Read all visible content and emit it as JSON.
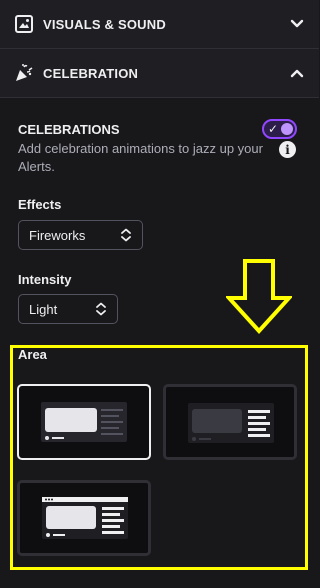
{
  "sections": {
    "visuals": {
      "label": "VISUALS & SOUND",
      "icon": "image-icon",
      "chevron": "chevron-down-icon"
    },
    "celebration": {
      "label": "CELEBRATION",
      "icon": "party-popper-icon",
      "chevron": "chevron-up-icon"
    }
  },
  "celebrations": {
    "title": "CELEBRATIONS",
    "description": "Add celebration animations to jazz up your Alerts.",
    "toggle_on": true
  },
  "effects": {
    "label": "Effects",
    "value": "Fireworks"
  },
  "intensity": {
    "label": "Intensity",
    "value": "Light"
  },
  "area": {
    "label": "Area",
    "options": [
      {
        "name": "layout-option-1",
        "selected": true
      },
      {
        "name": "layout-option-2",
        "selected": false
      },
      {
        "name": "layout-option-3",
        "selected": false
      }
    ]
  },
  "annotations": {
    "arrow_color": "#ffff00",
    "highlight_color": "#ffff00"
  },
  "colors": {
    "accent": "#9147ff",
    "background": "#18181b"
  }
}
